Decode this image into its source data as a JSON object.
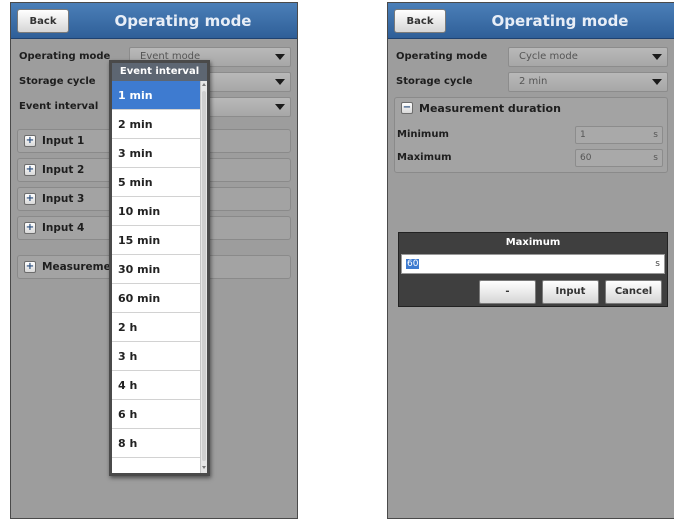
{
  "left": {
    "back_label": "Back",
    "title": "Operating mode",
    "rows": [
      {
        "label": "Operating mode",
        "value": "Event mode"
      },
      {
        "label": "Storage cycle",
        "value": ""
      },
      {
        "label": "Event interval",
        "value": ""
      }
    ],
    "groups": [
      "Input 1",
      "Input 2",
      "Input 3",
      "Input 4",
      "Measurement"
    ],
    "popup": {
      "title": "Event interval",
      "options": [
        "1 min",
        "2 min",
        "3 min",
        "5 min",
        "10 min",
        "15 min",
        "30 min",
        "60 min",
        "2 h",
        "3 h",
        "4 h",
        "6 h",
        "8 h"
      ],
      "selected_index": 0
    }
  },
  "right": {
    "back_label": "Back",
    "title": "Operating mode",
    "rows": [
      {
        "label": "Operating mode",
        "value": "Cycle mode"
      },
      {
        "label": "Storage cycle",
        "value": "2 min"
      }
    ],
    "section": {
      "label": "Measurement duration",
      "toggle": "−"
    },
    "fields": [
      {
        "label": "Minimum",
        "value": "1",
        "unit": "s"
      },
      {
        "label": "Maximum",
        "value": "60",
        "unit": "s"
      }
    ],
    "dialog": {
      "title": "Maximum",
      "value": "60",
      "unit": "s",
      "buttons": [
        "-",
        "Input",
        "Cancel"
      ]
    }
  },
  "colors": {
    "header": "#3a6ca6",
    "selection": "#3e7bd0",
    "screen_bg": "#9d9d9d"
  }
}
